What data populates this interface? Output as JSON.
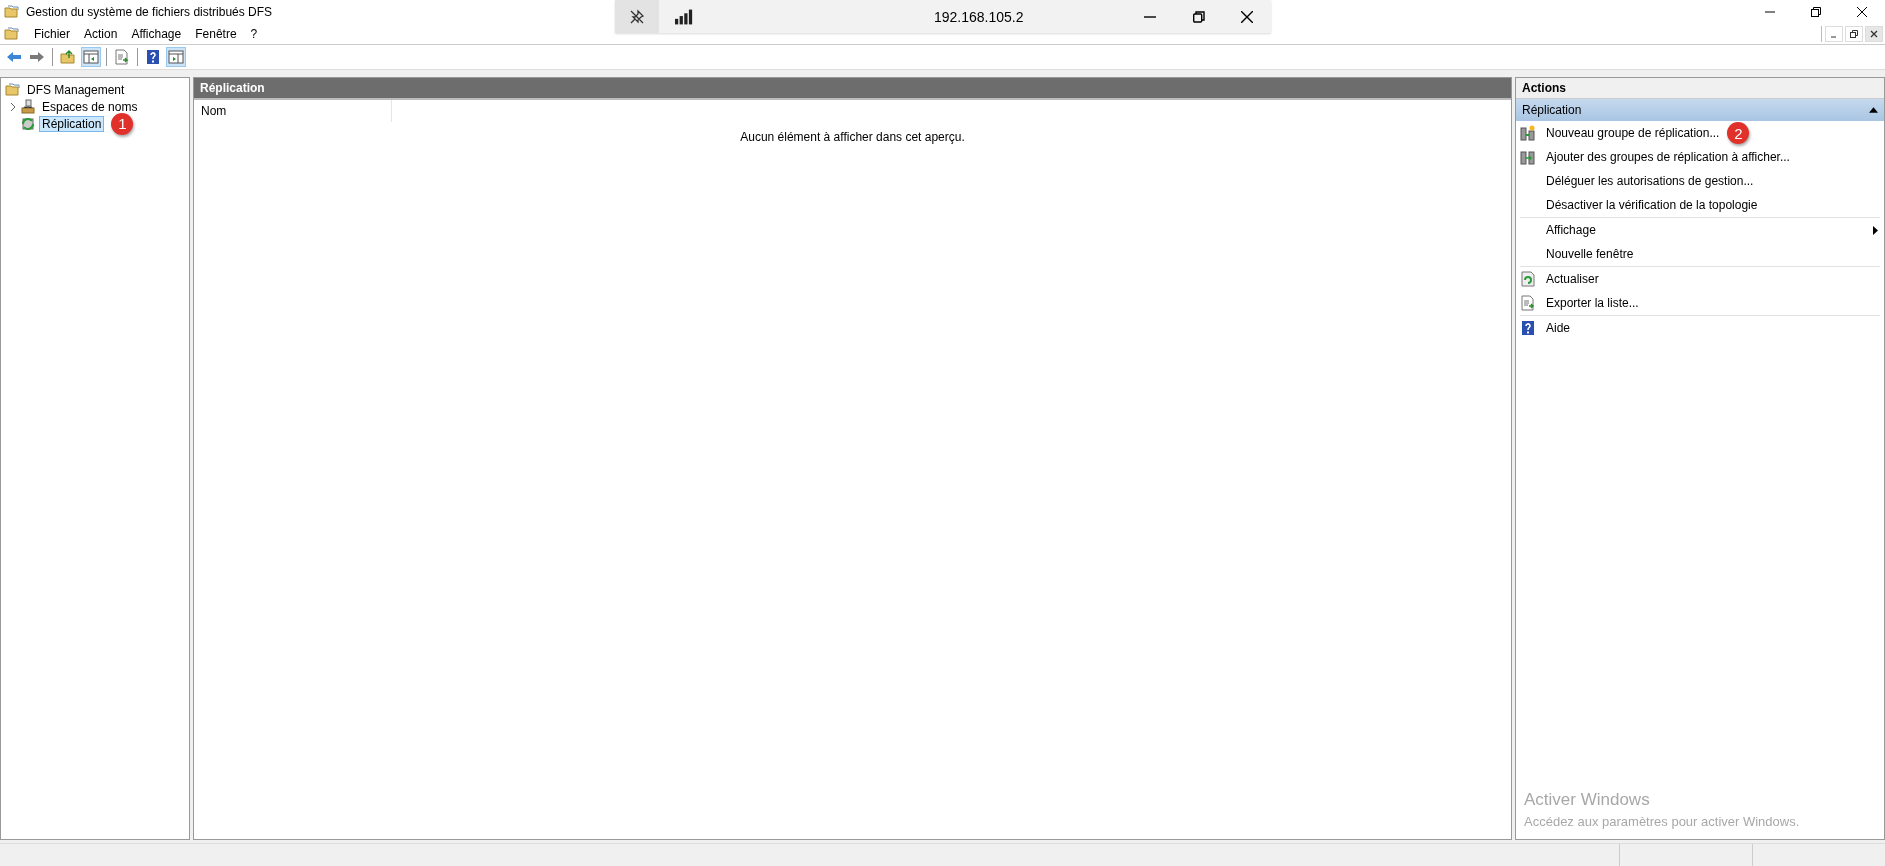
{
  "window": {
    "title": "Gestion du système de fichiers distribués DFS"
  },
  "remote_bar": {
    "address": "192.168.105.2"
  },
  "menu": [
    "Fichier",
    "Action",
    "Affichage",
    "Fenêtre",
    "?"
  ],
  "tree": [
    {
      "label": "DFS Management",
      "selected": false,
      "children": [
        {
          "label": "Espaces de noms",
          "selected": false,
          "expanded": false
        },
        {
          "label": "Réplication",
          "selected": true,
          "callout": "1"
        }
      ]
    }
  ],
  "center": {
    "title": "Réplication",
    "columns": [
      "Nom"
    ],
    "empty_message": "Aucun élément à afficher dans cet aperçu."
  },
  "actions": {
    "title": "Actions",
    "section": {
      "label": "Réplication",
      "expanded": true
    },
    "groups": [
      [
        {
          "label": "Nouveau groupe de réplication...",
          "callout": "2"
        },
        {
          "label": "Ajouter des groupes de réplication à afficher..."
        },
        {
          "label": "Déléguer les autorisations de gestion..."
        },
        {
          "label": "Désactiver la vérification de la topologie"
        }
      ],
      [
        {
          "label": "Affichage",
          "submenu": true
        },
        {
          "label": "Nouvelle fenêtre"
        }
      ],
      [
        {
          "label": "Actualiser"
        },
        {
          "label": "Exporter la liste..."
        }
      ],
      [
        {
          "label": "Aide"
        }
      ]
    ]
  },
  "activation_notice": {
    "title": "Activer Windows",
    "message": "Accédez aux paramètres pour activer Windows."
  }
}
